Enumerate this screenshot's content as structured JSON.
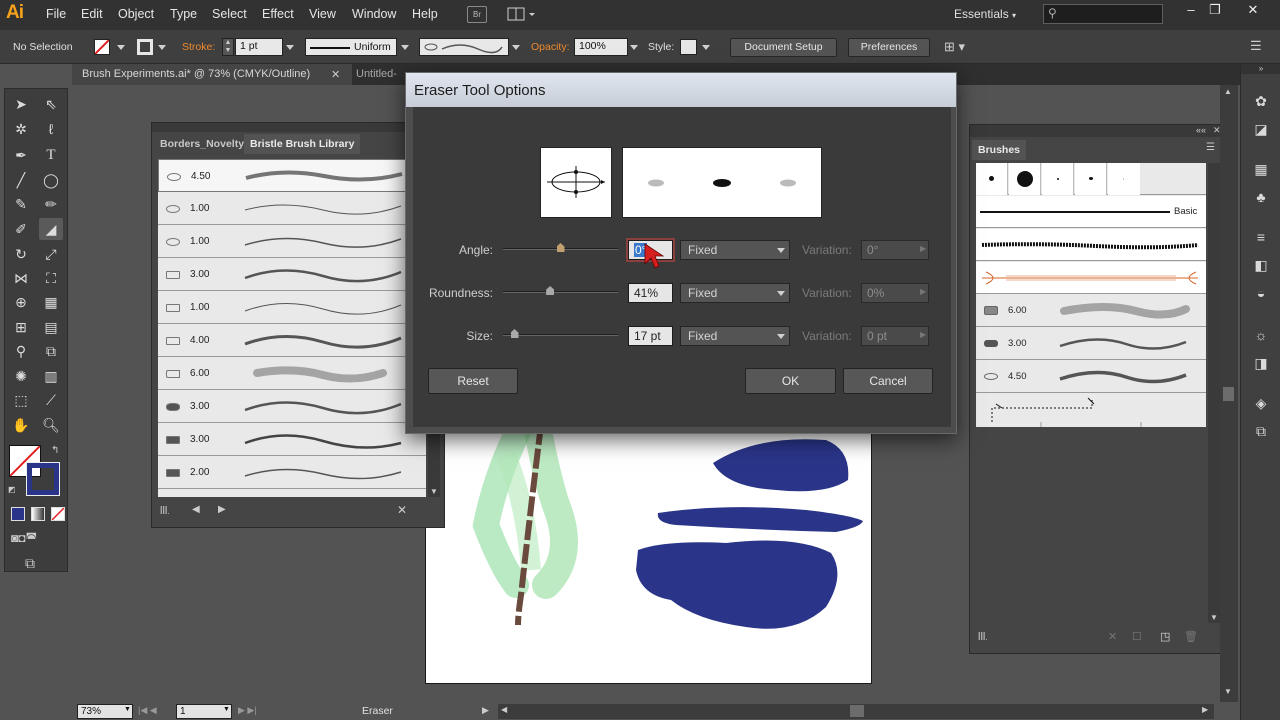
{
  "app": {
    "logo": "Ai",
    "menus": [
      "File",
      "Edit",
      "Object",
      "Type",
      "Select",
      "Effect",
      "View",
      "Window",
      "Help"
    ],
    "br_label": "Br",
    "workspace": "Essentials"
  },
  "controlbar": {
    "selection": "No Selection",
    "stroke_label": "Stroke:",
    "stroke_weight": "1 pt",
    "profile": "Uniform",
    "opacity_label": "Opacity:",
    "opacity": "100%",
    "style_label": "Style:",
    "doc_setup": "Document Setup",
    "preferences": "Preferences"
  },
  "tabs": [
    {
      "label": "Brush Experiments.ai* @ 73% (CMYK/Outline)"
    },
    {
      "label": "Untitled-"
    }
  ],
  "bristle_panel": {
    "tabs": [
      "Borders_Novelty",
      "Bristle Brush Library"
    ],
    "brushes": [
      "4.50",
      "1.00",
      "1.00",
      "3.00",
      "1.00",
      "4.00",
      "6.00",
      "3.00",
      "3.00",
      "2.00"
    ]
  },
  "brushes_panel": {
    "title": "Brushes",
    "basic_label": "Basic",
    "rows": [
      "6.00",
      "3.00",
      "4.50"
    ]
  },
  "dialog": {
    "title": "Eraser Tool Options",
    "angle": {
      "label": "Angle:",
      "value": "0°",
      "mode": "Fixed",
      "variation_label": "Variation:",
      "variation": "0°"
    },
    "roundness": {
      "label": "Roundness:",
      "value": "41%",
      "mode": "Fixed",
      "variation_label": "Variation:",
      "variation": "0%"
    },
    "size": {
      "label": "Size:",
      "value": "17 pt",
      "mode": "Fixed",
      "variation_label": "Variation:",
      "variation": "0 pt"
    },
    "reset": "Reset",
    "ok": "OK",
    "cancel": "Cancel",
    "angle_slider": 0.5,
    "roundness_slider": 0.41,
    "size_slider": 0.1
  },
  "status": {
    "zoom": "73%",
    "page": "1",
    "tool": "Eraser"
  },
  "colors": {
    "accent": "#f7a21b",
    "navy": "#2a3589",
    "green": "#6cd07a"
  }
}
